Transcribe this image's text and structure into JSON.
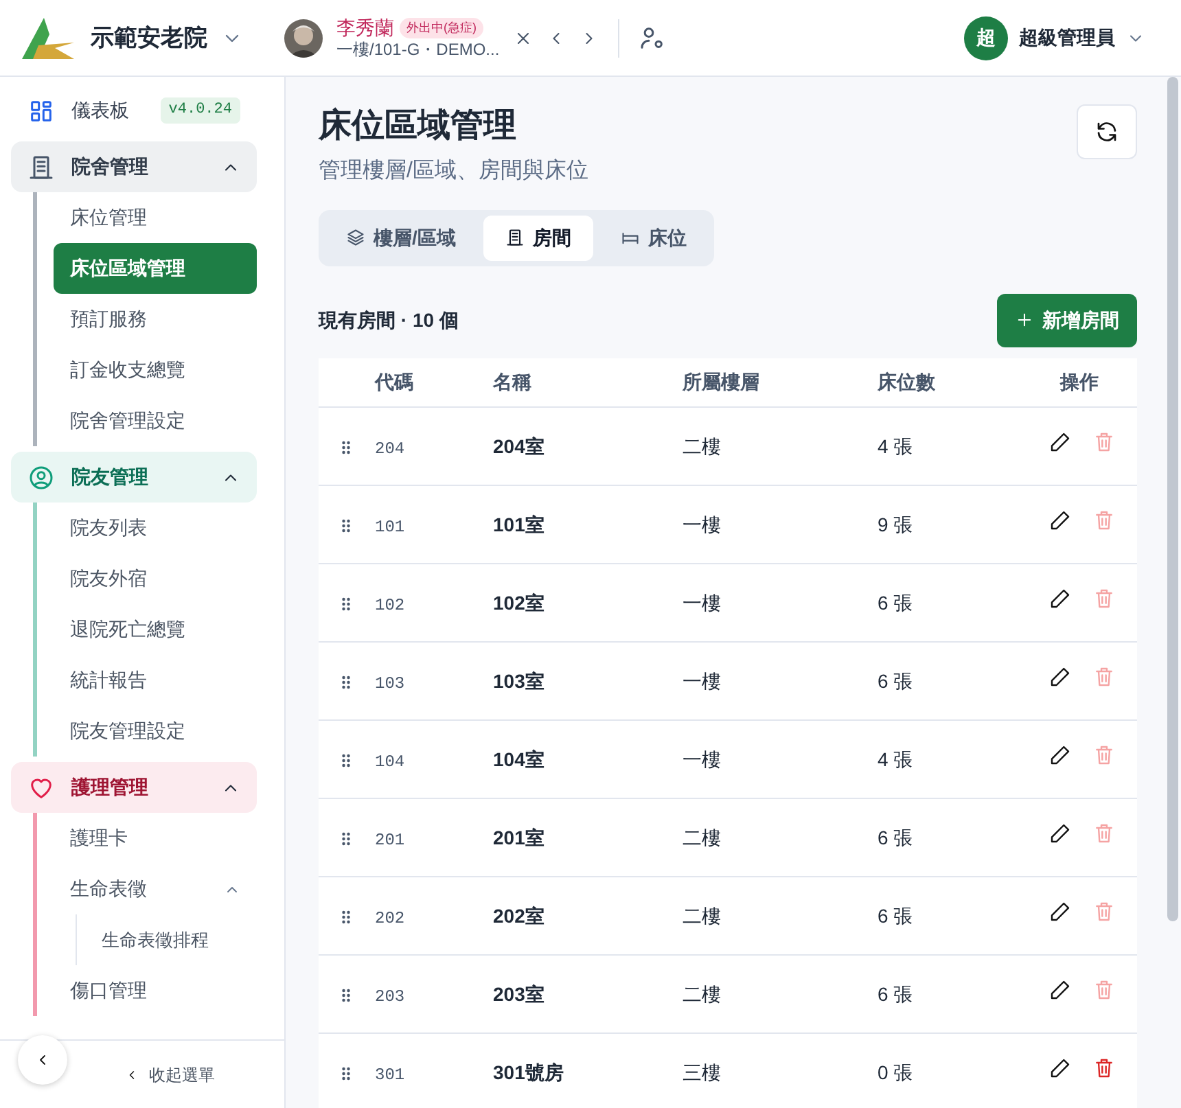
{
  "header": {
    "org_name": "示範安老院",
    "patient": {
      "name": "李秀蘭",
      "status_badge": "外出中(急症)",
      "location": "一樓/101-G・DEMO..."
    },
    "user": {
      "initial": "超",
      "name": "超級管理員"
    }
  },
  "sidebar": {
    "version": "v4.0.24",
    "dashboard": {
      "label": "儀表板",
      "selected": false
    },
    "groups": [
      {
        "label": "院舍管理",
        "color": "#475569",
        "expanded": true,
        "children": [
          {
            "label": "床位管理",
            "selected": false
          },
          {
            "label": "床位區域管理",
            "selected": true
          },
          {
            "label": "預訂服務",
            "selected": false
          },
          {
            "label": "訂金收支總覽",
            "selected": false
          },
          {
            "label": "院舍管理設定",
            "selected": false
          }
        ]
      },
      {
        "label": "院友管理",
        "color": "#0f9d7a",
        "expanded": true,
        "children": [
          {
            "label": "院友列表",
            "selected": false
          },
          {
            "label": "院友外宿",
            "selected": false
          },
          {
            "label": "退院死亡總覽",
            "selected": false
          },
          {
            "label": "統計報告",
            "selected": false
          },
          {
            "label": "院友管理設定",
            "selected": false
          }
        ]
      },
      {
        "label": "護理管理",
        "color": "#e11d48",
        "expanded": true,
        "children": [
          {
            "label": "護理卡",
            "selected": false
          },
          {
            "label": "生命表徵",
            "selected": false,
            "expanded": true,
            "children": [
              {
                "label": "生命表徵排程",
                "selected": false
              }
            ]
          },
          {
            "label": "傷口管理",
            "selected": false
          }
        ]
      }
    ],
    "collapse_label": "收起選單"
  },
  "page": {
    "title": "床位區域管理",
    "subtitle": "管理樓層/區域、房間與床位",
    "tabs": [
      {
        "label": "樓層/區域",
        "selected": false
      },
      {
        "label": "房間",
        "selected": true
      },
      {
        "label": "床位",
        "selected": false
      }
    ],
    "count_label": "現有房間 · 10 個",
    "add_button": "新增房間",
    "table": {
      "columns": [
        "代碼",
        "名稱",
        "所屬樓層",
        "床位數",
        "操作"
      ],
      "rows": [
        {
          "code": "204",
          "name": "204室",
          "floor": "二樓",
          "beds": "4 張",
          "delete_disabled": true
        },
        {
          "code": "101",
          "name": "101室",
          "floor": "一樓",
          "beds": "9 張",
          "delete_disabled": true
        },
        {
          "code": "102",
          "name": "102室",
          "floor": "一樓",
          "beds": "6 張",
          "delete_disabled": true
        },
        {
          "code": "103",
          "name": "103室",
          "floor": "一樓",
          "beds": "6 張",
          "delete_disabled": true
        },
        {
          "code": "104",
          "name": "104室",
          "floor": "一樓",
          "beds": "4 張",
          "delete_disabled": true
        },
        {
          "code": "201",
          "name": "201室",
          "floor": "二樓",
          "beds": "6 張",
          "delete_disabled": true
        },
        {
          "code": "202",
          "name": "202室",
          "floor": "二樓",
          "beds": "6 張",
          "delete_disabled": true
        },
        {
          "code": "203",
          "name": "203室",
          "floor": "二樓",
          "beds": "6 張",
          "delete_disabled": true
        },
        {
          "code": "301",
          "name": "301號房",
          "floor": "三樓",
          "beds": "0 張",
          "delete_disabled": false
        }
      ]
    }
  }
}
